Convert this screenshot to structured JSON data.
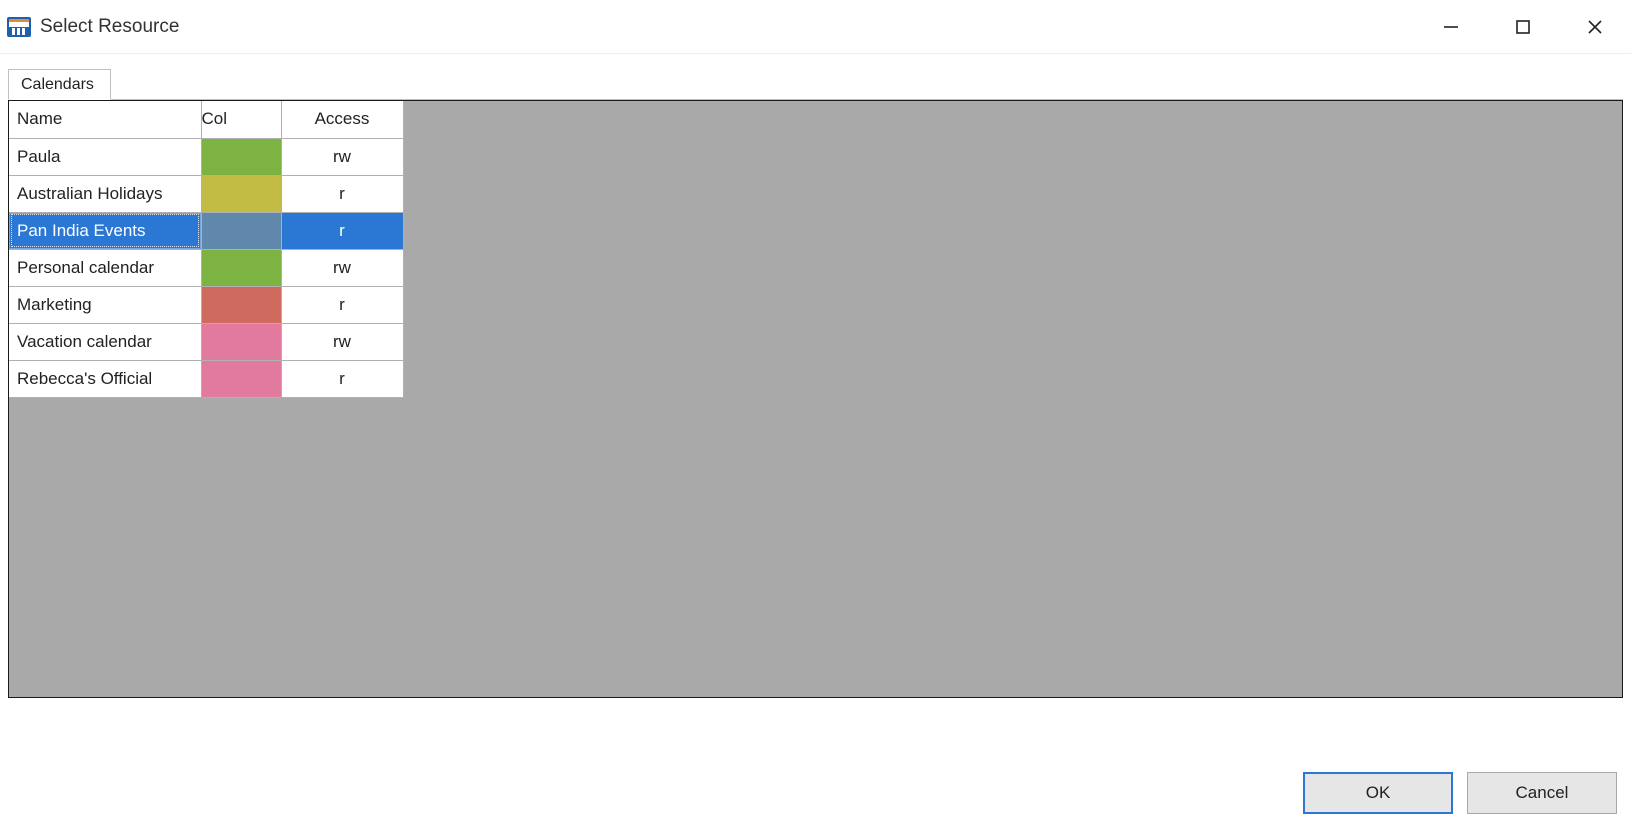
{
  "window": {
    "title": "Select Resource"
  },
  "tabs": [
    {
      "label": "Calendars",
      "active": true
    }
  ],
  "table": {
    "headers": {
      "name": "Name",
      "col": "Col",
      "access": "Access"
    },
    "rows": [
      {
        "name": "Paula",
        "color": "#7cb342",
        "access": "rw",
        "selected": false
      },
      {
        "name": "Australian Holidays",
        "color": "#c2bb44",
        "access": "r",
        "selected": false
      },
      {
        "name": "Pan India Events",
        "color": "#5f8fbd",
        "access": "r",
        "selected": true
      },
      {
        "name": "Personal calendar",
        "color": "#7cb342",
        "access": "rw",
        "selected": false
      },
      {
        "name": "Marketing",
        "color": "#cf6a5e",
        "access": "r",
        "selected": false
      },
      {
        "name": "Vacation calendar",
        "color": "#e27aa0",
        "access": "rw",
        "selected": false
      },
      {
        "name": "Rebecca's Official",
        "color": "#e27aa0",
        "access": "r",
        "selected": false
      }
    ]
  },
  "buttons": {
    "ok": "OK",
    "cancel": "Cancel"
  }
}
